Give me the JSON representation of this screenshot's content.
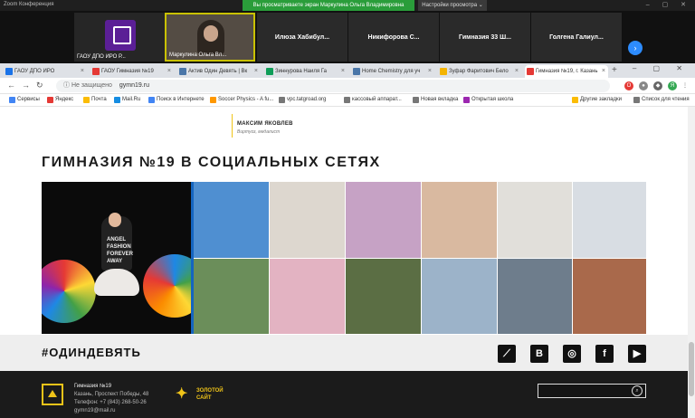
{
  "zoom": {
    "title": "Zoom Конференция",
    "screen_share_banner": "Вы просматриваете экран Маркулина Ольга Владимировна",
    "view_options": "Настройки просмотра ⌄",
    "window_controls": "– ▢ ✕"
  },
  "participants": [
    {
      "caption": "ГАОУ ДПО ИРО Р..."
    },
    {
      "caption": "Маркулина Ольга Вл..."
    },
    {
      "name": "Илюза  Хабибул..."
    },
    {
      "name": "Никифорова  С..."
    },
    {
      "name": "Гимназия 33 Ш..."
    },
    {
      "name": "Голгена  Галиул..."
    }
  ],
  "strip_arrow": "›",
  "tabs": [
    {
      "label": "ГАОУ ДПО ИРО",
      "color": "#1a73e8"
    },
    {
      "label": "ГАОУ Гимназия №19",
      "color": "#e53935"
    },
    {
      "label": "Актив Один Девять | Вк",
      "color": "#4a76a8"
    },
    {
      "label": "Зиннурова Наиля Га",
      "color": "#0f9d58"
    },
    {
      "label": "Home Chemistry для уч",
      "color": "#4a76a8"
    },
    {
      "label": "Зуфар Фаритович Бело",
      "color": "#f4b400"
    },
    {
      "label": "Гимназия №19, г. Казань",
      "color": "#e53935"
    }
  ],
  "new_tab": "+",
  "browser_controls": "– ▢ ✕",
  "nav": {
    "back": "←",
    "forward": "→",
    "reload": "↻"
  },
  "address": {
    "security": "ⓘ Не защищено",
    "url": "gymn19.ru"
  },
  "bookmarks": [
    {
      "label": "Сервисы",
      "color": "#4285f4"
    },
    {
      "label": "Яндекс",
      "color": "#e53935"
    },
    {
      "label": "Почта",
      "color": "#fbbc05"
    },
    {
      "label": "Mail.Ru",
      "color": "#168de2"
    },
    {
      "label": "Поиск в Интернете",
      "color": "#4285f4"
    },
    {
      "label": "Soccer Physics - A fu...",
      "color": "#ff9800"
    },
    {
      "label": "vpc.tatgroad.org",
      "color": "#777"
    },
    {
      "label": "кассовый аппарат...",
      "color": "#777"
    },
    {
      "label": "Новая вкладка",
      "color": "#777"
    },
    {
      "label": "Открытая школа",
      "color": "#9c27b0"
    },
    {
      "label": "Другие закладки",
      "color": "#fbbc05"
    },
    {
      "label": "Список для чтения",
      "color": "#777"
    }
  ],
  "page": {
    "author_name": "МАКСИМ ЯКОВЛЕВ",
    "author_role": "Виртуоз, медалист",
    "social_title": "ГИМНАЗИЯ №19 В СОЦИАЛЬНЫХ СЕТЯХ",
    "feature_photo_text": "ANGEL\nFASHION\nFOREVER\nAWAY",
    "hashtag": "#ОДИНДЕВЯТЬ",
    "social_icons": [
      {
        "label": "⟋",
        "name": "adobe-icon"
      },
      {
        "label": "В",
        "name": "vk-icon"
      },
      {
        "label": "◎",
        "name": "instagram-icon"
      },
      {
        "label": "f",
        "name": "facebook-icon"
      },
      {
        "label": "▶",
        "name": "youtube-icon"
      }
    ],
    "footer": {
      "name": "Гимназия №19",
      "address": "Казань, Проспект Победы, 48",
      "phone": "Телефон: +7 (843) 268-50-26",
      "email": "gymn19@mail.ru",
      "gold_line1": "ЗОЛОТОЙ",
      "gold_line2": "САЙТ",
      "search_icon": "⌕"
    }
  },
  "photo_colors": [
    "#4f8fd1",
    "#ddd7cf",
    "#c6a2c5",
    "#d9b9a0",
    "#e1dfda",
    "#d8dde3",
    "#6b8e5a",
    "#e3b3c2",
    "#5b6e44",
    "#9cb3c9",
    "#6e7d8c",
    "#a9694b"
  ]
}
